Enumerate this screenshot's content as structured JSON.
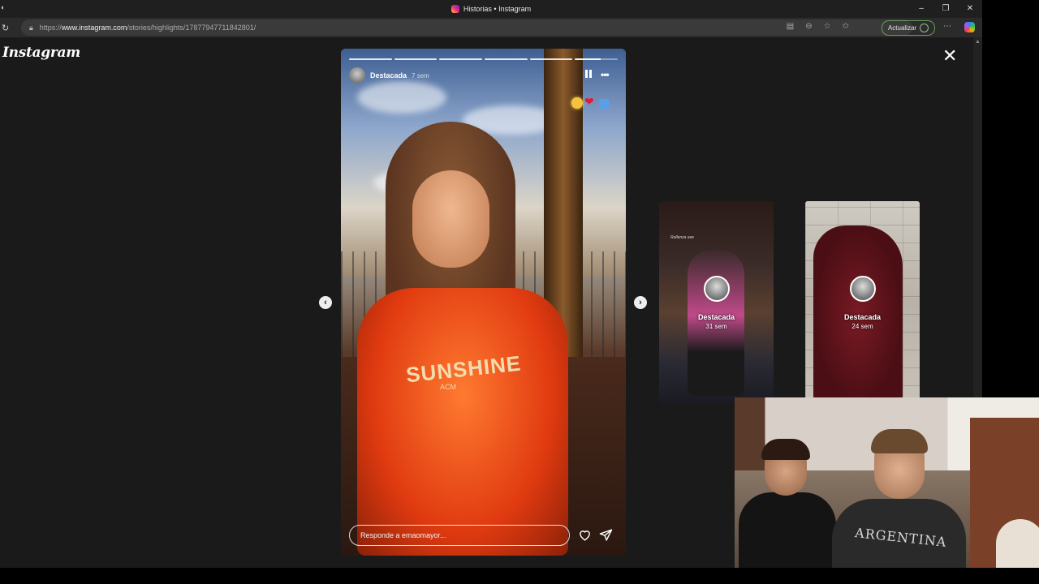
{
  "browser": {
    "tab_title": "Historias • Instagram",
    "url_prefix": "https://",
    "url_host": "www.instagram.com",
    "url_path": "/stories/highlights/17877947711842801/",
    "update_label": "Actualizar",
    "window_controls": [
      "–",
      "❐",
      "✕"
    ]
  },
  "page": {
    "logo": "Instagram"
  },
  "story": {
    "name": "Destacada",
    "time": "7 sem",
    "segments": 6,
    "shirt_text": "SUNSHINE",
    "shirt_sub": "ACM",
    "reply_placeholder": "Responde a emaomayor..."
  },
  "previews": [
    {
      "name": "Destacada",
      "time": "31 sem",
      "caption": "Rellenza ave"
    },
    {
      "name": "Destacada",
      "time": "24 sem"
    }
  ],
  "icons": {
    "close": "close-icon",
    "pause": "pause-icon",
    "more": "more-options-icon",
    "like": "heart-icon",
    "send": "send-icon"
  },
  "webcam": {
    "shirt_text": "ARGENTINA"
  }
}
